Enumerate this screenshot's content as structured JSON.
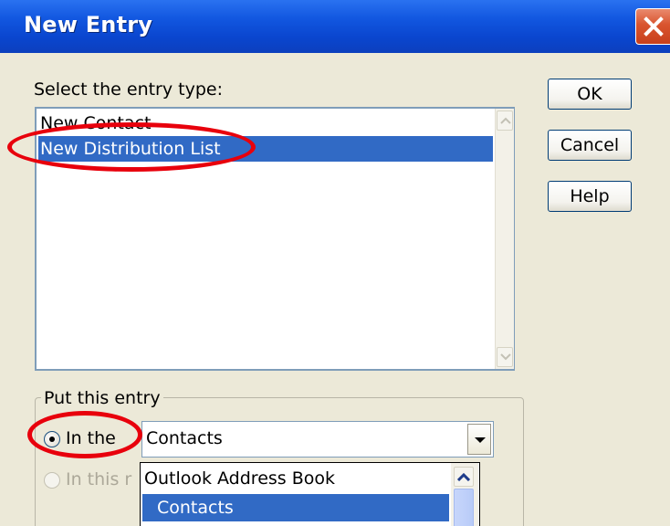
{
  "dialog": {
    "title": "New Entry",
    "close_icon": "close-x-icon"
  },
  "entry_type": {
    "label": "Select the entry type:",
    "items": [
      "New Contact",
      "New Distribution List"
    ],
    "selected_index": 1
  },
  "buttons": {
    "ok": "OK",
    "cancel": "Cancel",
    "help": "Help"
  },
  "location": {
    "group_label": "Put this entry",
    "option_in_the": "In the",
    "option_in_this": "In this",
    "option_in_this_fragment": "In this r",
    "combo_value": "Contacts",
    "dropdown_items": [
      "Outlook Address Book",
      "Contacts"
    ],
    "dropdown_selected_index": 1
  },
  "colors": {
    "titlebar": "#0a46cf",
    "selection": "#316ac5",
    "dialog_face": "#ece9d8",
    "annotation": "#e8000c"
  }
}
